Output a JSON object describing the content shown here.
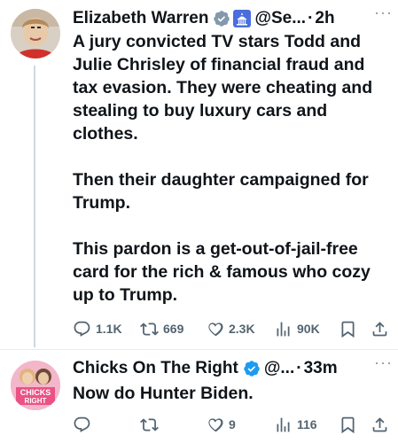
{
  "tweet1": {
    "name": "Elizabeth Warren",
    "handle": "@Se...",
    "dot": "·",
    "time": "2h",
    "more": "···",
    "paragraphs": [
      "A jury convicted TV stars Todd and Julie Chrisley of financial fraud and tax evasion. They were cheating and stealing to buy luxury cars and clothes.",
      "Then their daughter campaigned for Trump.",
      "This pardon is a get-out-of-jail-free card for the rich & famous who cozy up to Trump."
    ],
    "replies": "1.1K",
    "reposts": "669",
    "likes": "2.3K",
    "views": "90K"
  },
  "tweet2": {
    "name": "Chicks On The Right",
    "handle": "@...",
    "dot": "·",
    "time": "33m",
    "more": "···",
    "text": "Now do Hunter Biden.",
    "avatar_text": "CHICKS ON THE RIGHT",
    "likes": "9",
    "views": "116"
  },
  "colors": {
    "verified": "#1d9bf0",
    "gov_badge": "#4a6ee0",
    "icon": "#536471",
    "thread_line": "#cfd9de"
  }
}
